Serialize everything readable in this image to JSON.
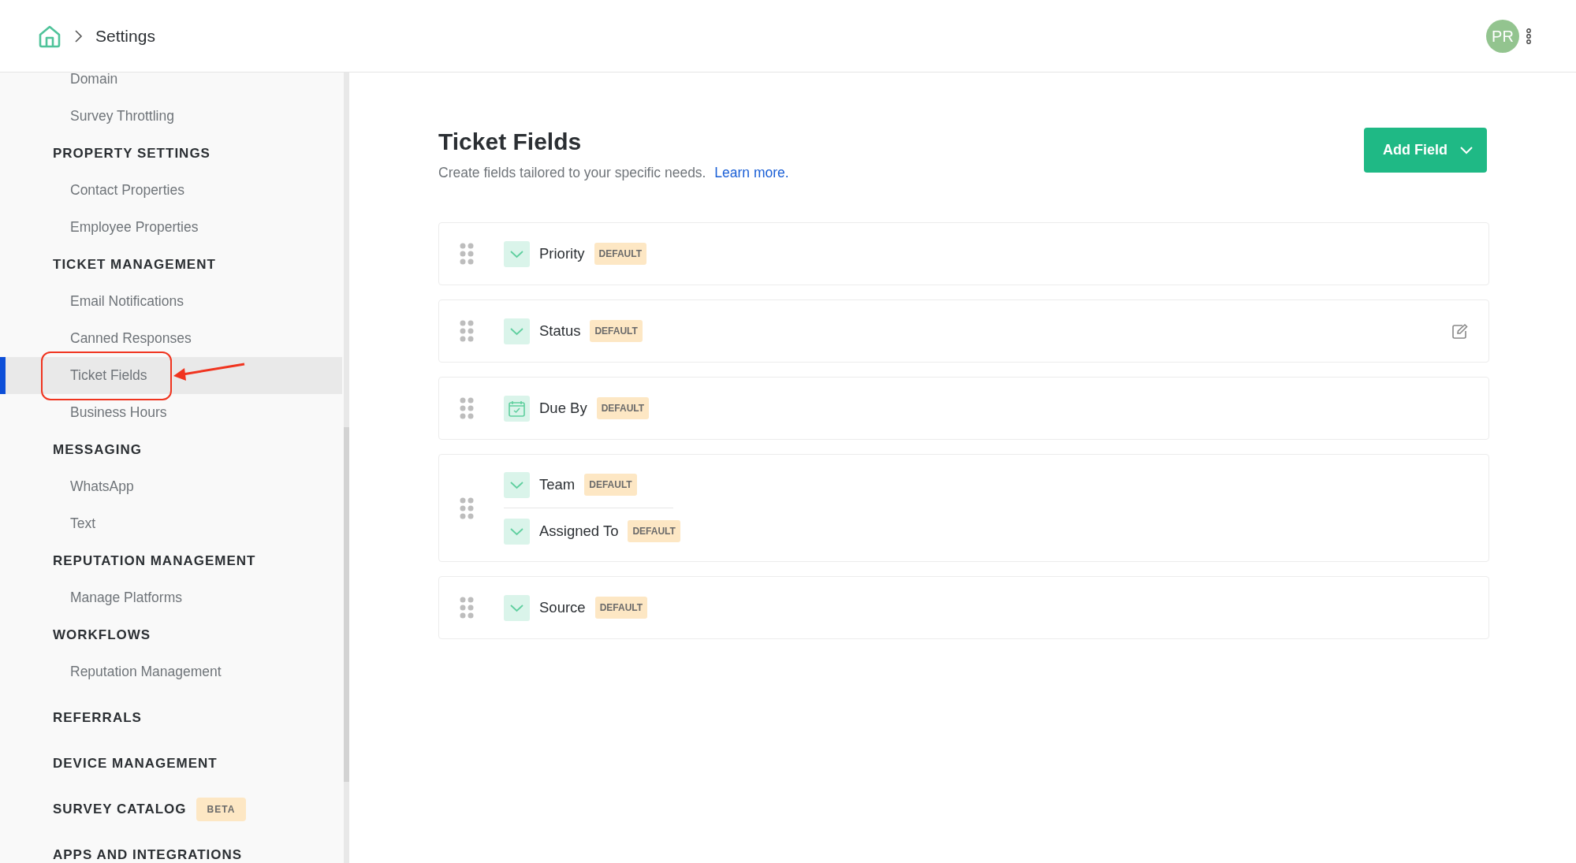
{
  "header": {
    "breadcrumb": [
      "Settings"
    ],
    "avatar": "PR"
  },
  "sidebar": {
    "sections": [
      {
        "items": [
          {
            "label": "Domain",
            "selected": false,
            "annotated": false
          },
          {
            "label": "Survey Throttling",
            "selected": false,
            "annotated": false
          }
        ]
      },
      {
        "heading": "PROPERTY SETTINGS",
        "items": [
          {
            "label": "Contact Properties",
            "selected": false,
            "annotated": false
          },
          {
            "label": "Employee Properties",
            "selected": false,
            "annotated": false
          }
        ]
      },
      {
        "heading": "TICKET MANAGEMENT",
        "items": [
          {
            "label": "Email Notifications",
            "selected": false,
            "annotated": false
          },
          {
            "label": "Canned Responses",
            "selected": false,
            "annotated": false
          },
          {
            "label": "Ticket Fields",
            "selected": true,
            "annotated": true
          },
          {
            "label": "Business Hours",
            "selected": false,
            "annotated": false
          }
        ]
      },
      {
        "heading": "MESSAGING",
        "items": [
          {
            "label": "WhatsApp",
            "selected": false,
            "annotated": false
          },
          {
            "label": "Text",
            "selected": false,
            "annotated": false
          }
        ]
      },
      {
        "heading": "REPUTATION MANAGEMENT",
        "items": [
          {
            "label": "Manage Platforms",
            "selected": false,
            "annotated": false
          }
        ]
      },
      {
        "heading": "WORKFLOWS",
        "items": [
          {
            "label": "Reputation Management",
            "selected": false,
            "annotated": false
          }
        ]
      },
      {
        "heading": "REFERRALS"
      },
      {
        "heading": "DEVICE MANAGEMENT"
      },
      {
        "heading": "SURVEY CATALOG",
        "badge": "BETA"
      },
      {
        "heading": "APPS AND INTEGRATIONS"
      }
    ]
  },
  "main": {
    "title": "Ticket Fields",
    "subtitle": "Create fields tailored to your specific needs.",
    "link": "Learn more.",
    "add_button": "Add Field",
    "rows": [
      {
        "editable": false,
        "fields": [
          {
            "label": "Priority",
            "kind": "dropdown",
            "badge": "DEFAULT"
          }
        ]
      },
      {
        "editable": true,
        "fields": [
          {
            "label": "Status",
            "kind": "dropdown",
            "badge": "DEFAULT"
          }
        ]
      },
      {
        "editable": false,
        "fields": [
          {
            "label": "Due By",
            "kind": "date",
            "badge": "DEFAULT"
          }
        ]
      },
      {
        "editable": false,
        "fields": [
          {
            "label": "Team",
            "kind": "dropdown",
            "badge": "DEFAULT"
          },
          {
            "label": "Assigned To",
            "kind": "dropdown",
            "badge": "DEFAULT"
          }
        ]
      },
      {
        "editable": false,
        "fields": [
          {
            "label": "Source",
            "kind": "dropdown",
            "badge": "DEFAULT"
          }
        ]
      }
    ]
  }
}
